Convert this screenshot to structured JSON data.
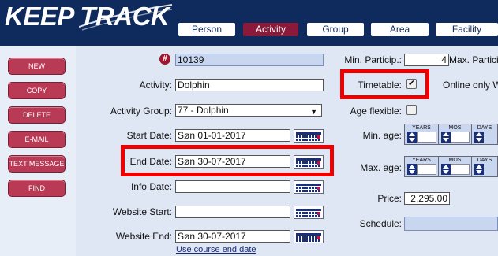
{
  "app": {
    "logo": "KEEP TRACK"
  },
  "nav": {
    "tabs": [
      {
        "label": "Person"
      },
      {
        "label": "Activity"
      },
      {
        "label": "Group"
      },
      {
        "label": "Area"
      },
      {
        "label": "Facility"
      }
    ]
  },
  "sidebar": {
    "buttons": [
      {
        "label": "NEW"
      },
      {
        "label": "COPY"
      },
      {
        "label": "DELETE"
      },
      {
        "label": "E-MAIL"
      },
      {
        "label": "TEXT MESSAGE"
      },
      {
        "label": "FIND"
      }
    ]
  },
  "form": {
    "id_value": "10139",
    "activity_label": "Activity:",
    "activity_value": "Dolphin",
    "group_label": "Activity Group:",
    "group_value": "77 - Dolphin",
    "start_label": "Start Date:",
    "start_value": "Søn 01-01-2017",
    "end_label": "End Date:",
    "end_value": "Søn 30-07-2017",
    "info_label": "Info Date:",
    "info_value": "",
    "web_start_label": "Website Start:",
    "web_start_value": "",
    "web_end_label": "Website End:",
    "web_end_value": "Søn 30-07-2017",
    "use_end_link": "Use course end date"
  },
  "right": {
    "min_particip_label": "Min. Particip.:",
    "min_particip_value": "4",
    "max_particip_label": "Max. Particip",
    "timetable_label": "Timetable:",
    "timetable_checked": true,
    "timetable_mark": "✔",
    "online_label": "Online only WI",
    "age_flex_label": "Age flexible:",
    "age_flex_checked": false,
    "min_age_label": "Min. age:",
    "max_age_label": "Max. age:",
    "years_label": "YEARS",
    "mos_label": "MOS",
    "days_label": "DAYS",
    "price_label": "Price:",
    "price_value": "2,295.00",
    "schedule_label": "Schedule:"
  },
  "colors": {
    "nav": "#0f2a5c",
    "active_tab": "#8b1a3a",
    "button": "#b83a55",
    "highlight": "#ee0000"
  }
}
